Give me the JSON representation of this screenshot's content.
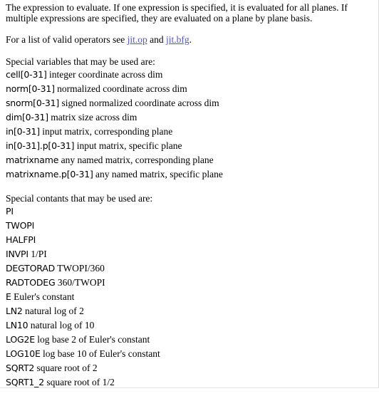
{
  "intro": {
    "text": "The expression to evaluate. If one expression is specified, it is evaluated for all planes. If multiple expressions are specified, they are evaluated on a plane by plane basis."
  },
  "operators": {
    "prefix": "For a list of valid operators see ",
    "link1": "jit.op",
    "middle": " and ",
    "link2": "jit.bfg",
    "suffix": "."
  },
  "variables": {
    "heading": "Special variables that may be used are:",
    "items": [
      {
        "name": "cell[0-31]",
        "desc": " integer coordinate across dim"
      },
      {
        "name": "norm[0-31]",
        "desc": " normalized coordinate across dim"
      },
      {
        "name": "snorm[0-31]",
        "desc": " signed normalized coordinate across dim"
      },
      {
        "name": "dim[0-31]",
        "desc": " matrix size across dim"
      },
      {
        "name": "in[0-31]",
        "desc": " input matrix, corresponding plane"
      },
      {
        "name": "in[0-31].p[0-31]",
        "desc": " input matrix, specific plane"
      },
      {
        "name": "matrixname",
        "desc": " any named matrix, corresponding plane"
      },
      {
        "name": "matrixname.p[0-31]",
        "desc": " any named matrix, specific plane"
      }
    ]
  },
  "constants": {
    "heading": "Special contants that may be used are:",
    "items": [
      {
        "name": "PI",
        "desc": ""
      },
      {
        "name": "TWOPI",
        "desc": ""
      },
      {
        "name": "HALFPI",
        "desc": ""
      },
      {
        "name": "INVPI",
        "desc": " 1/PI"
      },
      {
        "name": "DEGTORAD",
        "desc": " TWOPI/360"
      },
      {
        "name": "RADTODEG",
        "desc": " 360/TWOPI"
      },
      {
        "name": "E",
        "desc": " Euler's constant"
      },
      {
        "name": "LN2",
        "desc": " natural log of 2"
      },
      {
        "name": "LN10",
        "desc": " natural log of 10"
      },
      {
        "name": "LOG2E",
        "desc": " log base 2 of Euler's constant"
      },
      {
        "name": "LOG10E",
        "desc": " log base 10 of Euler's constant"
      },
      {
        "name": "SQRT2",
        "desc": " square root of 2"
      },
      {
        "name": "SQRT1_2",
        "desc": " square root of 1/2"
      }
    ]
  },
  "colors": {
    "link": "#5555cc",
    "text": "#000000"
  }
}
